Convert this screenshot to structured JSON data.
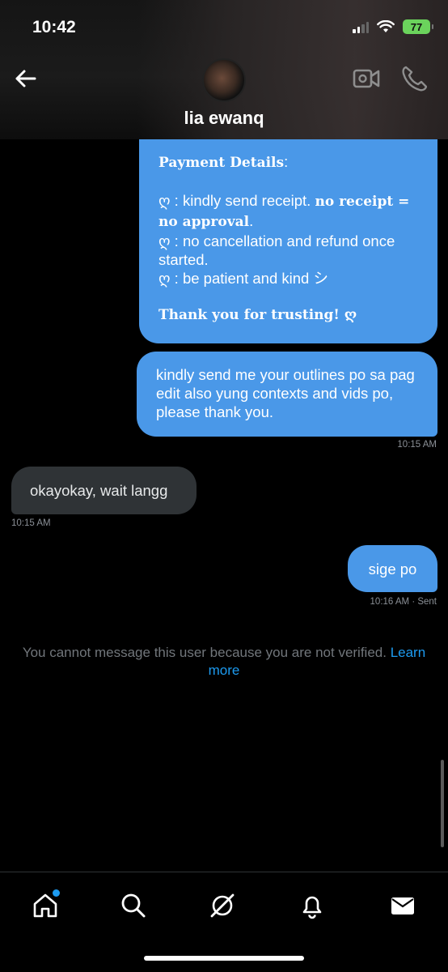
{
  "status_bar": {
    "time": "10:42",
    "battery": "77"
  },
  "header": {
    "contact_name": "lia ewanq",
    "icons": [
      "arrow-left-icon",
      "video-icon",
      "phone-icon"
    ]
  },
  "messages": {
    "payment": {
      "title": "Payment Details",
      "colon": ":",
      "l1_prefix": "ღ : kindly send receipt. ",
      "l1_bold": "no receipt =",
      "l2_bold": "no approval",
      "l2_suffix": ".",
      "l3": "ღ : no cancellation and refund once",
      "l4": "started.",
      "l5": "ღ : be patient and kind シ",
      "thanks": "Thank you for trusting! ღ"
    },
    "outlines": {
      "text": "kindly send me your outlines po sa pag edit also yung contexts and vids po, please thank you.",
      "time": "10:15 AM"
    },
    "okay": {
      "text": "okayokay, wait langg",
      "time": "10:15 AM"
    },
    "sige": {
      "text": "sige po",
      "time": "10:16 AM · Sent"
    }
  },
  "notice": {
    "text": "You cannot message this user because you are not verified. ",
    "link_1": "Learn",
    "link_2": "more"
  },
  "bottom_nav": {
    "items": [
      "home-icon",
      "search-icon",
      "grok-icon",
      "bell-icon",
      "mail-icon"
    ],
    "accent": "#1d9bf0"
  },
  "colors": {
    "sent_bubble": "#4a98e8",
    "received_bubble": "#2f3336",
    "battery": "#6bd35c"
  }
}
